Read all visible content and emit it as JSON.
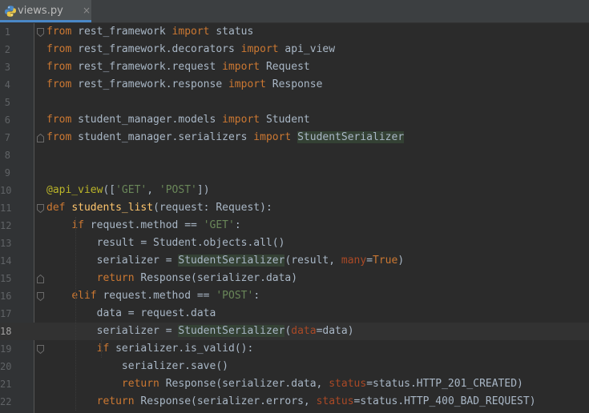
{
  "tab": {
    "filename": "views.py",
    "close_glyph": "×"
  },
  "lines": [
    {
      "n": "1",
      "tokens": [
        [
          "kw",
          "from"
        ],
        [
          "t",
          " rest_framework "
        ],
        [
          "kw",
          "import"
        ],
        [
          "t",
          " status"
        ]
      ]
    },
    {
      "n": "2",
      "tokens": [
        [
          "kw",
          "from"
        ],
        [
          "t",
          " rest_framework.decorators "
        ],
        [
          "kw",
          "import"
        ],
        [
          "t",
          " api_view"
        ]
      ]
    },
    {
      "n": "3",
      "tokens": [
        [
          "kw",
          "from"
        ],
        [
          "t",
          " rest_framework.request "
        ],
        [
          "kw",
          "import"
        ],
        [
          "t",
          " Request"
        ]
      ]
    },
    {
      "n": "4",
      "tokens": [
        [
          "kw",
          "from"
        ],
        [
          "t",
          " rest_framework.response "
        ],
        [
          "kw",
          "import"
        ],
        [
          "t",
          " Response"
        ]
      ]
    },
    {
      "n": "5",
      "tokens": []
    },
    {
      "n": "6",
      "tokens": [
        [
          "kw",
          "from"
        ],
        [
          "t",
          " student_manager.models "
        ],
        [
          "kw",
          "import"
        ],
        [
          "t",
          " Student"
        ]
      ]
    },
    {
      "n": "7",
      "tokens": [
        [
          "kw",
          "from"
        ],
        [
          "t",
          " student_manager.serializers "
        ],
        [
          "kw",
          "import"
        ],
        [
          "t",
          " "
        ],
        [
          "hl",
          "StudentSerializer"
        ]
      ]
    },
    {
      "n": "8",
      "tokens": []
    },
    {
      "n": "9",
      "tokens": []
    },
    {
      "n": "10",
      "tokens": [
        [
          "dec",
          "@api_view"
        ],
        [
          "t",
          "(["
        ],
        [
          "str",
          "'GET'"
        ],
        [
          "t",
          ", "
        ],
        [
          "str",
          "'POST'"
        ],
        [
          "t",
          "])"
        ]
      ]
    },
    {
      "n": "11",
      "tokens": [
        [
          "kw",
          "def"
        ],
        [
          "t",
          " "
        ],
        [
          "fn",
          "students_list"
        ],
        [
          "t",
          "(request: Request):"
        ]
      ]
    },
    {
      "n": "12",
      "tokens": [
        [
          "t",
          "    "
        ],
        [
          "kw",
          "if"
        ],
        [
          "t",
          " request.method == "
        ],
        [
          "str",
          "'GET'"
        ],
        [
          "t",
          ":"
        ]
      ]
    },
    {
      "n": "13",
      "tokens": [
        [
          "t",
          "        result = Student.objects.all()"
        ]
      ]
    },
    {
      "n": "14",
      "tokens": [
        [
          "t",
          "        serializer = "
        ],
        [
          "hl",
          "StudentSerializer"
        ],
        [
          "t",
          "(result, "
        ],
        [
          "param",
          "many"
        ],
        [
          "t",
          "="
        ],
        [
          "kw",
          "True"
        ],
        [
          "t",
          ")"
        ]
      ]
    },
    {
      "n": "15",
      "tokens": [
        [
          "t",
          "        "
        ],
        [
          "kw",
          "return"
        ],
        [
          "t",
          " Response(serializer.data)"
        ]
      ]
    },
    {
      "n": "16",
      "tokens": [
        [
          "t",
          "    "
        ],
        [
          "kw",
          "elif"
        ],
        [
          "t",
          " request.method == "
        ],
        [
          "str",
          "'POST'"
        ],
        [
          "t",
          ":"
        ]
      ]
    },
    {
      "n": "17",
      "tokens": [
        [
          "t",
          "        data = request.data"
        ]
      ]
    },
    {
      "n": "18",
      "tokens": [
        [
          "t",
          "        serializer = "
        ],
        [
          "hl",
          "StudentSerializer"
        ],
        [
          "t",
          "("
        ],
        [
          "param",
          "data"
        ],
        [
          "t",
          "=data)"
        ]
      ]
    },
    {
      "n": "19",
      "tokens": [
        [
          "t",
          "        "
        ],
        [
          "kw",
          "if"
        ],
        [
          "t",
          " serializer.is_valid():"
        ]
      ]
    },
    {
      "n": "20",
      "tokens": [
        [
          "t",
          "            serializer.save()"
        ]
      ]
    },
    {
      "n": "21",
      "tokens": [
        [
          "t",
          "            "
        ],
        [
          "kw",
          "return"
        ],
        [
          "t",
          " Response(serializer.data, "
        ],
        [
          "param",
          "status"
        ],
        [
          "t",
          "=status.HTTP_201_CREATED)"
        ]
      ]
    },
    {
      "n": "22",
      "tokens": [
        [
          "t",
          "        "
        ],
        [
          "kw",
          "return"
        ],
        [
          "t",
          " Response(serializer.errors, "
        ],
        [
          "param",
          "status"
        ],
        [
          "t",
          "=status.HTTP_400_BAD_REQUEST)"
        ]
      ]
    }
  ],
  "current_line": "18",
  "colors": {
    "background": "#2b2b2b",
    "gutter": "#313335",
    "keyword": "#cc7832",
    "string": "#6a8759",
    "decorator": "#bbb529",
    "function": "#ffc66d",
    "parameter": "#aa4926",
    "text": "#a9b7c6",
    "usage_highlight": "#344134",
    "current_line": "#323232",
    "tab_underline": "#4a88c7"
  },
  "icons": {
    "tab": "python-file-icon",
    "close": "close-icon",
    "fold_open": "fold-start-icon",
    "fold_close": "fold-end-icon"
  }
}
